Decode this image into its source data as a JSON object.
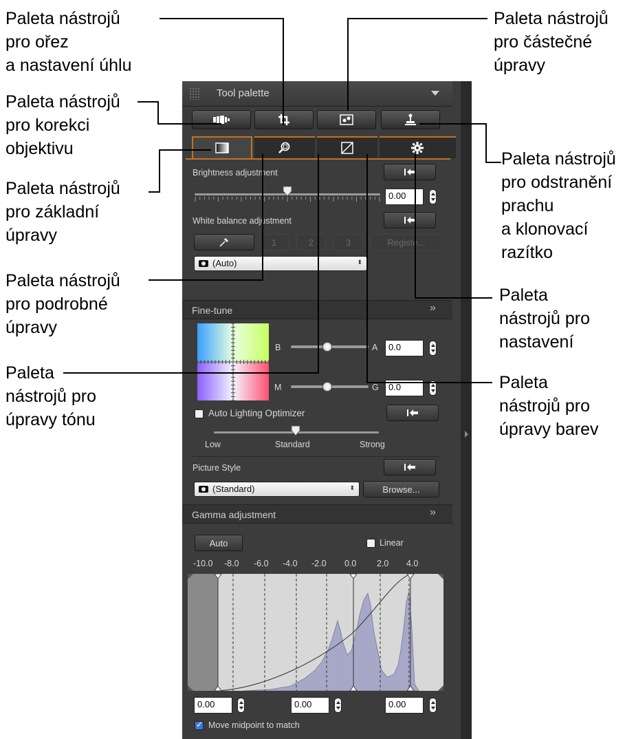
{
  "callouts": {
    "crop": "Paleta nástrojů\npro ořez\na nastavení úhlu",
    "partial": "Paleta nástrojů\npro částečné\núpravy",
    "lens": "Paleta nástrojů\npro korekci\nobjektivu",
    "dust": "Paleta nástrojů\npro odstranění\nprachu\na klonovací\nrazítko",
    "basic": "Paleta nástrojů\npro základní\núpravy",
    "detailed": "Paleta nástrojů\npro podrobné\núpravy",
    "settings": "Paleta\nnástrojů pro\nnastavení",
    "tone": "Paleta\nnástrojů pro\núpravy tónu",
    "color": "Paleta\nnástrojů pro\núpravy barev"
  },
  "palette": {
    "title": "Tool palette",
    "top_buttons": [
      "lens-correction-icon",
      "crop-icon",
      "partial-adjust-icon",
      "stamp-icon"
    ],
    "tabs": [
      "basic-adjust-icon",
      "detail-adjust-icon",
      "tone-adjust-icon",
      "color-adjust-icon",
      "settings-icon"
    ],
    "active_tab": 0
  },
  "brightness": {
    "label": "Brightness adjustment",
    "value": "0.00",
    "level": 0.5
  },
  "white_balance": {
    "label": "White balance adjustment",
    "presets": [
      "1",
      "2",
      "3"
    ],
    "register_label": "Registe...",
    "selected": "(Auto)"
  },
  "fine_tune": {
    "title": "Fine-tune",
    "b_label": "B",
    "a_label": "A",
    "a_value": "0.0",
    "m_label": "M",
    "g_label": "G",
    "g_value": "0.0"
  },
  "alo": {
    "label": "Auto Lighting Optimizer",
    "checked": false,
    "levels": [
      "Low",
      "Standard",
      "Strong"
    ],
    "selected": "Standard"
  },
  "picture_style": {
    "label": "Picture Style",
    "selected": "(Standard)",
    "browse_label": "Browse..."
  },
  "gamma": {
    "title": "Gamma adjustment",
    "auto_label": "Auto",
    "linear_label": "Linear",
    "linear_checked": false,
    "ticks": [
      "-10.0",
      "-8.0",
      "-6.0",
      "-4.0",
      "-2.0",
      "0.0",
      "2.0",
      "4.0"
    ],
    "values": [
      "0.00",
      "0.00",
      "0.00"
    ],
    "midpoint_label": "Move midpoint to match",
    "midpoint_checked": true
  },
  "colors": {
    "accent": "#c4721c",
    "panel": "#3c3c3c",
    "histogram": "#a7a7c8"
  }
}
